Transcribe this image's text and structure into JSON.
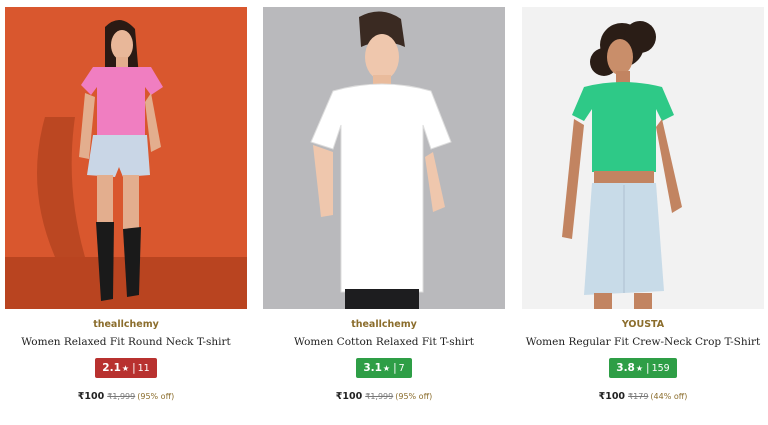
{
  "products": [
    {
      "brand": "theallchemy",
      "title": "Women Relaxed Fit Round Neck T-shirt",
      "rating": "2.1",
      "star": "★",
      "separator": "|",
      "reviews": "11",
      "rating_color": "#b8312f",
      "price": "₹100",
      "mrp": "₹1,999",
      "discount": "(95% off)",
      "image": {
        "background": "#d9572e",
        "top_color": "#f07ec1",
        "bottom_color": "#c9d6e6"
      }
    },
    {
      "brand": "theallchemy",
      "title": "Women Cotton Relaxed Fit T-shirt",
      "rating": "3.1",
      "star": "★",
      "separator": "|",
      "reviews": "7",
      "rating_color": "#2e9e46",
      "price": "₹100",
      "mrp": "₹1,999",
      "discount": "(95% off)",
      "image": {
        "background": "#b9b9bc",
        "top_color": "#ffffff",
        "bottom_color": "#1d1d1f"
      }
    },
    {
      "brand": "YOUSTA",
      "title": "Women Regular Fit Crew-Neck Crop T-Shirt",
      "rating": "3.8",
      "star": "★",
      "separator": "|",
      "reviews": "159",
      "rating_color": "#2e9e46",
      "price": "₹100",
      "mrp": "₹179",
      "discount": "(44% off)",
      "image": {
        "background": "#f2f2f2",
        "top_color": "#2ec987",
        "bottom_color": "#c8dbe8"
      }
    }
  ]
}
